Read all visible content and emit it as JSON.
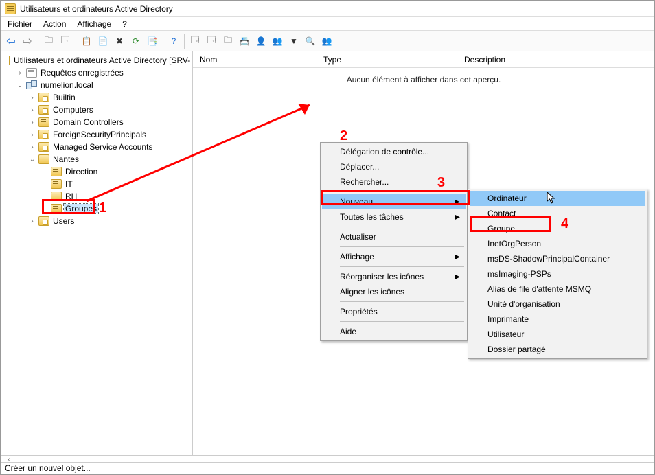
{
  "title": "Utilisateurs et ordinateurs Active Directory",
  "menus": {
    "file": "Fichier",
    "action": "Action",
    "view": "Affichage",
    "help": "?"
  },
  "tree": {
    "root": "Utilisateurs et ordinateurs Active Directory [SRV-",
    "saved": "Requêtes enregistrées",
    "domain": "numelion.local",
    "builtin": "Builtin",
    "computers": "Computers",
    "dcs": "Domain Controllers",
    "fsp": "ForeignSecurityPrincipals",
    "msa": "Managed Service Accounts",
    "nantes": "Nantes",
    "direction": "Direction",
    "it": "IT",
    "rh": "RH",
    "groupes": "Groupes",
    "users": "Users"
  },
  "list": {
    "cols": {
      "nom": "Nom",
      "type": "Type",
      "desc": "Description"
    },
    "empty": "Aucun élément à afficher dans cet aperçu."
  },
  "ctx1": {
    "delegation": "Délégation de contrôle...",
    "move": "Déplacer...",
    "search": "Rechercher...",
    "new": "Nouveau",
    "alltasks": "Toutes les tâches",
    "refresh": "Actualiser",
    "display": "Affichage",
    "arrange": "Réorganiser les icônes",
    "align": "Aligner les icônes",
    "props": "Propriétés",
    "help": "Aide"
  },
  "ctx2": {
    "computer": "Ordinateur",
    "contact": "Contact",
    "group": "Groupe",
    "inetorg": "InetOrgPerson",
    "msds": "msDS-ShadowPrincipalContainer",
    "msimg": "msImaging-PSPs",
    "msmq": "Alias de file d'attente MSMQ",
    "ou": "Unité d'organisation",
    "printer": "Imprimante",
    "user": "Utilisateur",
    "shared": "Dossier partagé"
  },
  "annotations": {
    "a1": "1",
    "a2": "2",
    "a3": "3",
    "a4": "4"
  },
  "status": "Créer un nouvel objet..."
}
